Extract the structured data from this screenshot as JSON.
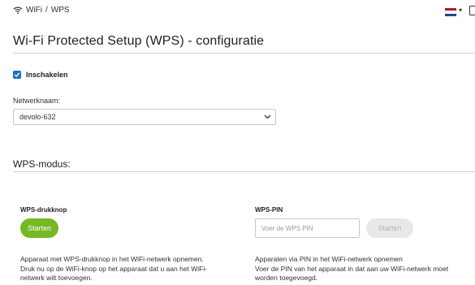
{
  "breadcrumb": {
    "section": "WiFi",
    "separator": "/",
    "page": "WPS"
  },
  "page_title": "Wi-Fi Protected Setup (WPS) - configuratie",
  "enable": {
    "label": "Inschakelen",
    "checked": true
  },
  "network": {
    "label": "Netwerknaam:",
    "value": "devolo-632"
  },
  "wps_mode": {
    "title": "WPS-modus:",
    "push_button": {
      "title": "WPS-drukknop",
      "button_label": "Starten",
      "description_lines": [
        "Apparaat met WPS-drukknop in het WiFi-netwerk opnemen.",
        "Druk nu op de WiFi-knop op het apparaat dat u aan het WiFi-",
        "netwerk wilt toevoegen."
      ]
    },
    "pin": {
      "title": "WPS-PIN",
      "placeholder": "Voer de WPS PIN",
      "button_label": "Starten",
      "description_lines": [
        "Apparaten via PIN in het WiFi-netwerk opnemen",
        "Voer de PIN van het apparaat in dat aan uw WiFi-netwerk moet",
        "worden toegevoegd."
      ]
    }
  },
  "icons": {
    "wifi": "wifi-icon",
    "flag": "netherlands-flag-icon",
    "caret": "caret-down-icon",
    "document": "document-icon",
    "checkbox": "check-icon",
    "select_caret": "chevron-down-icon"
  },
  "colors": {
    "accent_green": "#75b824",
    "checkbox_blue": "#1e6fbf",
    "flag_red": "#ae1c28",
    "flag_white": "#ffffff",
    "flag_blue": "#21468b"
  }
}
